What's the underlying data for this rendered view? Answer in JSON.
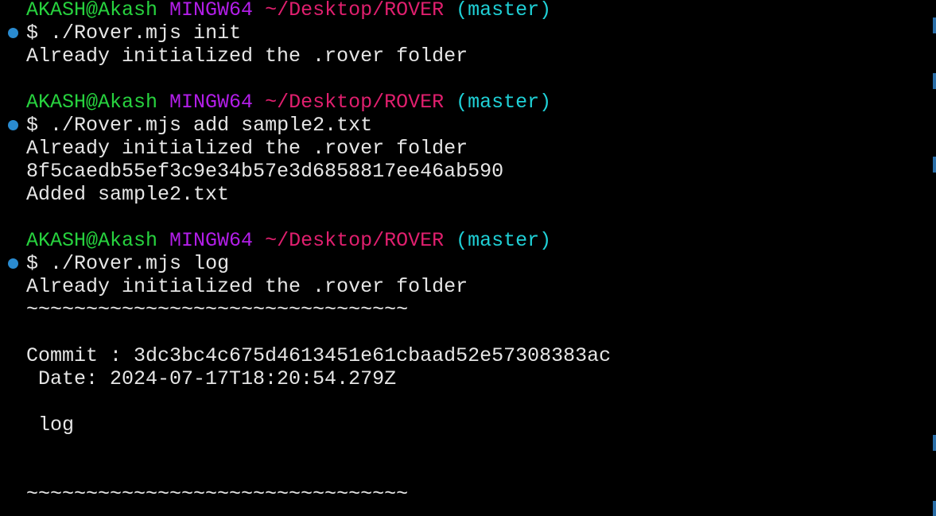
{
  "prompt": {
    "user_host": "AKASH@Akash",
    "system": "MINGW64",
    "path": "~/Desktop/ROVER",
    "branch": "(master)",
    "symbol": "$"
  },
  "blocks": [
    {
      "command": "./Rover.mjs init",
      "output": [
        "Already initialized the .rover folder"
      ]
    },
    {
      "command": "./Rover.mjs add sample2.txt",
      "output": [
        "Already initialized the .rover folder",
        "8f5caedb55ef3c9e34b57e3d6858817ee46ab590",
        "Added sample2.txt"
      ]
    },
    {
      "command": "./Rover.mjs log",
      "output": [
        "Already initialized the .rover folder",
        "~~~~~~~~~~~~~~~~~~~~~~~~~~~~~~~~",
        "",
        "Commit : 3dc3bc4c675d4613451e61cbaad52e57308383ac",
        " Date: 2024-07-17T18:20:54.279Z",
        "",
        " log",
        "",
        "",
        "~~~~~~~~~~~~~~~~~~~~~~~~~~~~~~~~"
      ]
    }
  ],
  "colors": {
    "background": "#000000",
    "user_host": "#27d23e",
    "system": "#b21ee8",
    "path": "#e01f6e",
    "branch": "#1fd0d6",
    "text": "#e6e6e6",
    "status_dot": "#2a8bd0"
  }
}
